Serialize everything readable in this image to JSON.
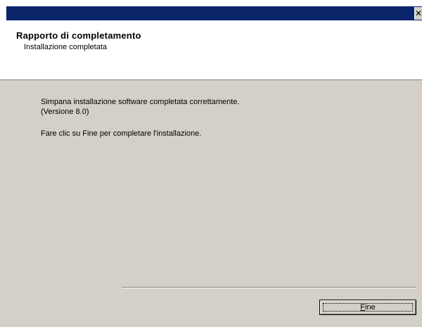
{
  "window": {
    "close_glyph": "✕",
    "colors": {
      "titlebar": "#0a246a",
      "face": "#d4d0c8",
      "header_bg": "#ffffff"
    }
  },
  "header": {
    "title": "Rapporto di completamento",
    "subtitle": "Installazione completata"
  },
  "content": {
    "line1": "Simpana installazione software completata correttamente.",
    "line2": "(Versione 8.0)",
    "line3": "Fare clic su Fine per completare l'installazione."
  },
  "buttons": {
    "finish_mnemonic": "F",
    "finish_rest": "ine"
  }
}
